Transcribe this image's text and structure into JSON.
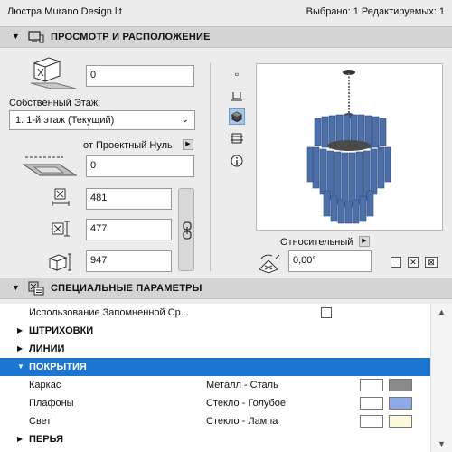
{
  "window": {
    "title": "Люстра Murano Design lit",
    "status": "Выбрано: 1 Редактируемых: 1"
  },
  "section_preview": {
    "title": "ПРОСМОТР И РАСПОЛОЖЕНИЕ",
    "elevation_value": "0",
    "home_story_label": "Собственный Этаж:",
    "home_story_value": "1. 1-й этаж (Текущий)",
    "reference_label": "от Проектный Нуль",
    "ref_elevation_value": "0",
    "width_value": "481",
    "depth_value": "477",
    "height_value": "947",
    "relative_label": "Относительный",
    "angle_value": "0,00°"
  },
  "section_params": {
    "title": "СПЕЦИАЛЬНЫЕ ПАРАМЕТРЫ",
    "use_stored_label": "Использование Запомненной Ср...",
    "groups": {
      "hatches": "ШТРИХОВКИ",
      "lines": "ЛИНИИ",
      "surfaces": "ПОКРЫТИЯ",
      "pens": "ПЕРЬЯ"
    },
    "surfaces": [
      {
        "name": "Каркас",
        "value": "Металл - Сталь",
        "color": "#8a8a8a"
      },
      {
        "name": "Плафоны",
        "value": "Стекло - Голубое",
        "color": "#8fa9e6"
      },
      {
        "name": "Свет",
        "value": "Стекло - Лампа",
        "color": "#fdf9dc"
      }
    ]
  },
  "colors": {
    "selection": "#1c76d1",
    "header": "#d4d4d4",
    "chandelier": "#4d6fa8"
  }
}
